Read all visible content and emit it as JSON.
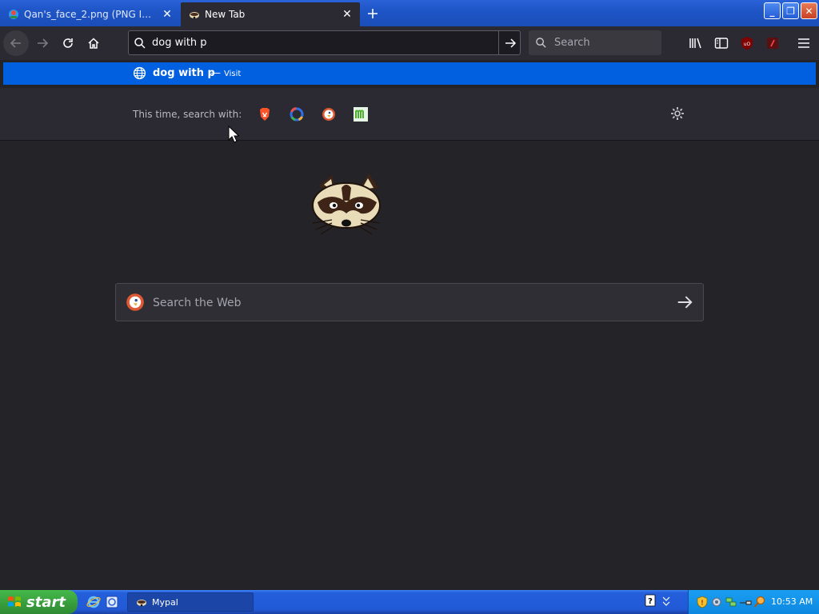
{
  "tabs": [
    {
      "label": "Qan's_face_2.png (PNG Image, 1",
      "active": false
    },
    {
      "label": "New Tab",
      "active": true
    }
  ],
  "window_controls": {
    "minimize": "_",
    "maximize": "❐",
    "close": "✕"
  },
  "urlbar": {
    "value": "dog with p"
  },
  "searchbox": {
    "placeholder": "Search"
  },
  "suggestion": {
    "text": "dog with p",
    "separator": "—",
    "action": "Visit"
  },
  "oneoff": {
    "label": "This time, search with:",
    "engines": [
      "brave-icon",
      "qwant-icon",
      "duckduckgo-icon",
      "mojeek-icon"
    ]
  },
  "web_search": {
    "placeholder": "Search the Web"
  },
  "taskbar": {
    "start_label": "start",
    "task_label": "Mypal",
    "clock": "10:53 AM"
  },
  "colors": {
    "accent": "#0060df",
    "toolbar": "#2b2a33",
    "page_bg": "#242328",
    "taskbar": "#245edb",
    "start": "#379c3c"
  }
}
